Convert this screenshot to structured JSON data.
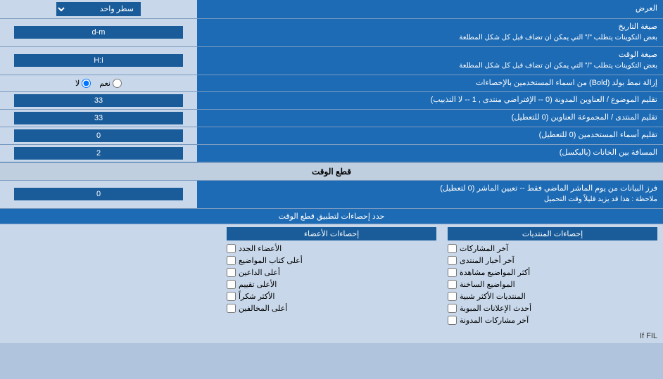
{
  "header": {
    "عرض_label": "العرض",
    "سطر_label": "سطر واحد"
  },
  "rows": [
    {
      "id": "date-format",
      "label": "صيغة التاريخ\nبعض التكوينات يتطلب \"/\" التي يمكن ان تضاف قبل كل شكل المطلعة",
      "input_value": "d-m",
      "type": "text"
    },
    {
      "id": "time-format",
      "label": "صيغة الوقت\nبعض التكوينات يتطلب \"/\" التي يمكن ان تضاف قبل كل شكل المطلعة",
      "input_value": "H:i",
      "type": "text"
    },
    {
      "id": "bold-remove",
      "label": "إزالة نمط بولد (Bold) من اسماء المستخدمين بالإحصاءات",
      "type": "radio",
      "options": [
        "نعم",
        "لا"
      ],
      "selected": "لا"
    },
    {
      "id": "topic-title",
      "label": "تقليم الموضوع / العناوين المدونة (0 -- الإفتراضي منتدى , 1 -- لا التذبيب)",
      "input_value": "33",
      "type": "text"
    },
    {
      "id": "forum-title",
      "label": "تقليم المنتدى / المجموعة العناوين (0 للتعطيل)",
      "input_value": "33",
      "type": "text"
    },
    {
      "id": "user-names",
      "label": "تقليم أسماء المستخدمين (0 للتعطيل)",
      "input_value": "0",
      "type": "text"
    },
    {
      "id": "spacing",
      "label": "المسافة بين الخانات (بالبكسل)",
      "input_value": "2",
      "type": "text"
    }
  ],
  "cutoff_section": {
    "header": "قطع الوقت",
    "row": {
      "label": "فرز البيانات من يوم الماشر الماضي فقط -- تعيين الماشر (0 لتعطيل)\nملاحظة : هذا قد يزيد قليلاً وقت التحميل",
      "input_value": "0",
      "right_label": "حدد إحصاءات لتطبيق قطع الوقت"
    }
  },
  "checkboxes": {
    "col1": {
      "header": "إحصاءات المنتديات",
      "items": [
        "آخر المشاركات",
        "آخر أخبار المنتدى",
        "أكثر المواضيع مشاهدة",
        "المواضيع الساخنة",
        "المنتديات الأكثر شبية",
        "أحدث الإعلانات المبوبة",
        "آخر مشاركات المدونة"
      ]
    },
    "col2": {
      "header": "إحصاءات الأعضاء",
      "items": [
        "الأعضاء الجدد",
        "أعلى كتاب المواضيع",
        "أعلى الداعين",
        "الأعلى تقييم",
        "الأكثر شكراً",
        "أعلى المخالفين"
      ]
    },
    "col3_header": "حدد إحصاءات لتطبيق قطع الوقت"
  },
  "footer_note": "If FIL"
}
